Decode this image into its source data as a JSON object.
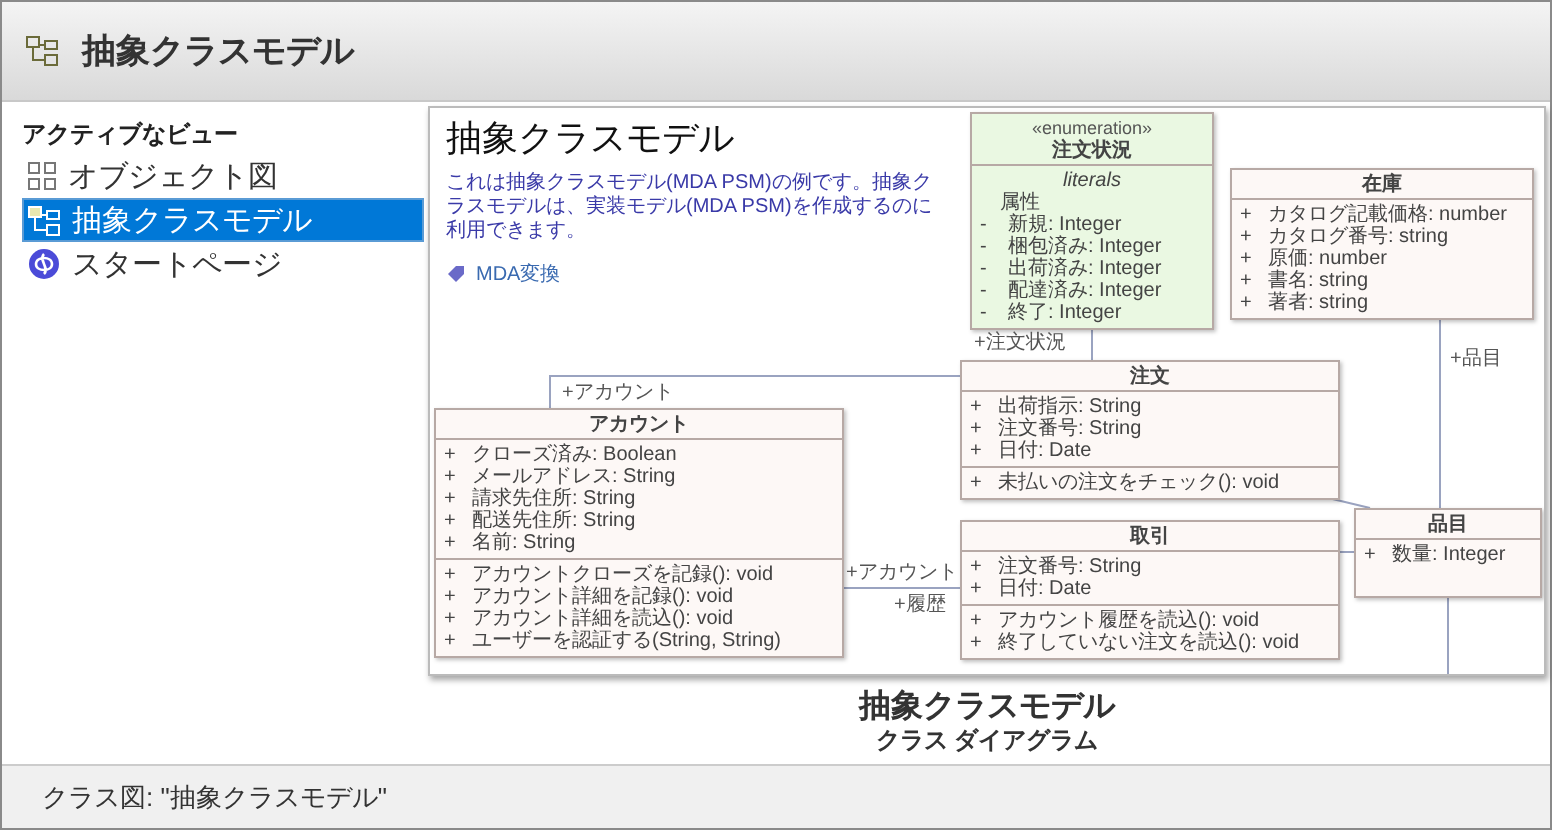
{
  "header": {
    "title": "抽象クラスモデル"
  },
  "sidebar": {
    "heading": "アクティブなビュー",
    "items": [
      {
        "label": "オブジェクト図",
        "kind": "object-diagram",
        "selected": false
      },
      {
        "label": "抽象クラスモデル",
        "kind": "class-diagram",
        "selected": true
      },
      {
        "label": "スタートページ",
        "kind": "start-page",
        "selected": false
      }
    ]
  },
  "preview": {
    "title": "抽象クラスモデル",
    "description": "これは抽象クラスモデル(MDA PSM)の例です。抽象クラスモデルは、実装モデル(MDA PSM)を作成するのに利用できます。",
    "link": "MDA変換",
    "classes": [
      {
        "kind": "enumeration",
        "stereotype": "«enumeration»",
        "name": "注文状況",
        "section_label": "literals",
        "group_label": "属性",
        "attributes": [
          {
            "visibility": "-",
            "text": "新規: Integer"
          },
          {
            "visibility": "-",
            "text": "梱包済み: Integer"
          },
          {
            "visibility": "-",
            "text": "出荷済み: Integer"
          },
          {
            "visibility": "-",
            "text": "配達済み: Integer"
          },
          {
            "visibility": "-",
            "text": "終了: Integer"
          }
        ]
      },
      {
        "kind": "class",
        "name": "在庫",
        "attributes": [
          {
            "visibility": "+",
            "text": "カタログ記載価格: number"
          },
          {
            "visibility": "+",
            "text": "カタログ番号: string"
          },
          {
            "visibility": "+",
            "text": "原価: number"
          },
          {
            "visibility": "+",
            "text": "書名: string"
          },
          {
            "visibility": "+",
            "text": "著者: string"
          }
        ]
      },
      {
        "kind": "class",
        "name": "注文",
        "attributes": [
          {
            "visibility": "+",
            "text": "出荷指示: String"
          },
          {
            "visibility": "+",
            "text": "注文番号: String"
          },
          {
            "visibility": "+",
            "text": "日付: Date"
          }
        ],
        "operations": [
          {
            "visibility": "+",
            "text": "未払いの注文をチェック(): void"
          }
        ]
      },
      {
        "kind": "class",
        "name": "アカウント",
        "attributes": [
          {
            "visibility": "+",
            "text": "クローズ済み: Boolean"
          },
          {
            "visibility": "+",
            "text": "メールアドレス: String"
          },
          {
            "visibility": "+",
            "text": "請求先住所: String"
          },
          {
            "visibility": "+",
            "text": "配送先住所: String"
          },
          {
            "visibility": "+",
            "text": "名前: String"
          }
        ],
        "operations": [
          {
            "visibility": "+",
            "text": "アカウントクローズを記録(): void"
          },
          {
            "visibility": "+",
            "text": "アカウント詳細を記録(): void"
          },
          {
            "visibility": "+",
            "text": "アカウント詳細を読込(): void"
          },
          {
            "visibility": "+",
            "text": "ユーザーを認証する(String, String)"
          }
        ]
      },
      {
        "kind": "class",
        "name": "取引",
        "attributes": [
          {
            "visibility": "+",
            "text": "注文番号: String"
          },
          {
            "visibility": "+",
            "text": "日付: Date"
          }
        ],
        "operations": [
          {
            "visibility": "+",
            "text": "アカウント履歴を読込(): void"
          },
          {
            "visibility": "+",
            "text": "終了していない注文を読込(): void"
          }
        ]
      },
      {
        "kind": "class",
        "name": "品目",
        "attributes": [
          {
            "visibility": "+",
            "text": "数量: Integer"
          }
        ]
      }
    ],
    "role_labels": [
      "+注文状況",
      "+品目",
      "+アカウント",
      "+アカウント",
      "+履歴"
    ]
  },
  "caption": {
    "title": "抽象クラスモデル",
    "subtitle": "クラス ダイアグラム"
  },
  "status_bar": "クラス図: \"抽象クラスモデル\""
}
